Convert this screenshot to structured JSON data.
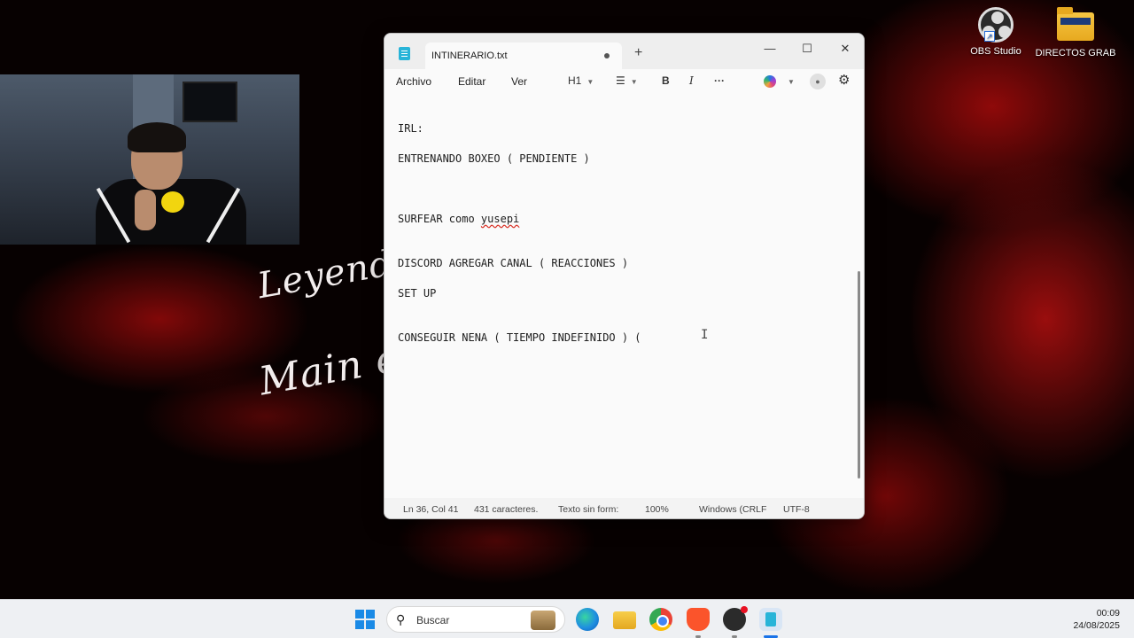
{
  "wallpaper": {
    "script_words": [
      "Leyenda",
      "Main e"
    ]
  },
  "desktop_icons": [
    {
      "label": "OBS Studio",
      "icon": "obs-studio-icon"
    },
    {
      "label": "DIRECTOS GRAB",
      "icon": "folder-icon"
    }
  ],
  "notepad": {
    "tab_title": "INTINERARIO.txt",
    "menu": [
      "Archivo",
      "Editar",
      "Ver"
    ],
    "toolbar": {
      "heading": "H1",
      "bold": "B",
      "italic": "I",
      "more": "···"
    },
    "lines": [
      {
        "text": "IRL:"
      },
      {
        "text": "ENTRENANDO BOXEO ( PENDIENTE )"
      },
      {
        "text_before": "SURFEAR como ",
        "misspelled": "yusepi"
      },
      {
        "text": "DISCORD AGREGAR CANAL ( REACCIONES )"
      },
      {
        "text": "SET UP"
      },
      {
        "text": "CONSEGUIR NENA ( TIEMPO INDEFINIDO ) ("
      }
    ],
    "status": {
      "position": "Ln 36, Col 41",
      "chars": "431 caracteres.",
      "format": "Texto sin form:",
      "zoom": "100%",
      "line_ending": "Windows (CRLF",
      "encoding": "UTF-8"
    }
  },
  "taskbar": {
    "search_placeholder": "Buscar",
    "apps": [
      "edge-icon",
      "file-explorer-icon",
      "chrome-icon",
      "brave-icon",
      "obs-studio-icon",
      "notepad-icon"
    ],
    "time": "00:09",
    "date": "24/08/2025"
  },
  "colors": {
    "accent": "#1a73e8",
    "wallpaper_red": "#9a0c0c",
    "window_bg": "#fafafa"
  }
}
